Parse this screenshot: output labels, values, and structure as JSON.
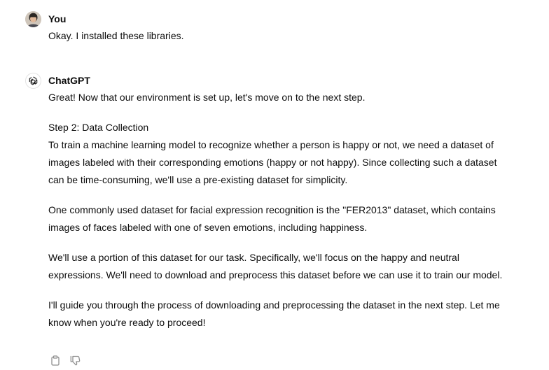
{
  "user_message": {
    "author": "You",
    "text": "Okay. I installed these libraries."
  },
  "assistant_message": {
    "author": "ChatGPT",
    "paragraph_1": "Great! Now that our environment is set up, let's move on to the next step.",
    "step_heading": "Step 2: Data Collection",
    "paragraph_2": "To train a machine learning model to recognize whether a person is happy or not, we need a dataset of images labeled with their corresponding emotions (happy or not happy). Since collecting such a dataset can be time-consuming, we'll use a pre-existing dataset for simplicity.",
    "paragraph_3": "One commonly used dataset for facial expression recognition is the \"FER2013\" dataset, which contains images of faces labeled with one of seven emotions, including happiness.",
    "paragraph_4": "We'll use a portion of this dataset for our task. Specifically, we'll focus on the happy and neutral expressions. We'll need to download and preprocess this dataset before we can use it to train our model.",
    "paragraph_5": "I'll guide you through the process of downloading and preprocessing the dataset in the next step. Let me know when you're ready to proceed!"
  },
  "actions": {
    "copy_icon": "clipboard-icon",
    "dislike_icon": "thumbs-down-icon"
  }
}
